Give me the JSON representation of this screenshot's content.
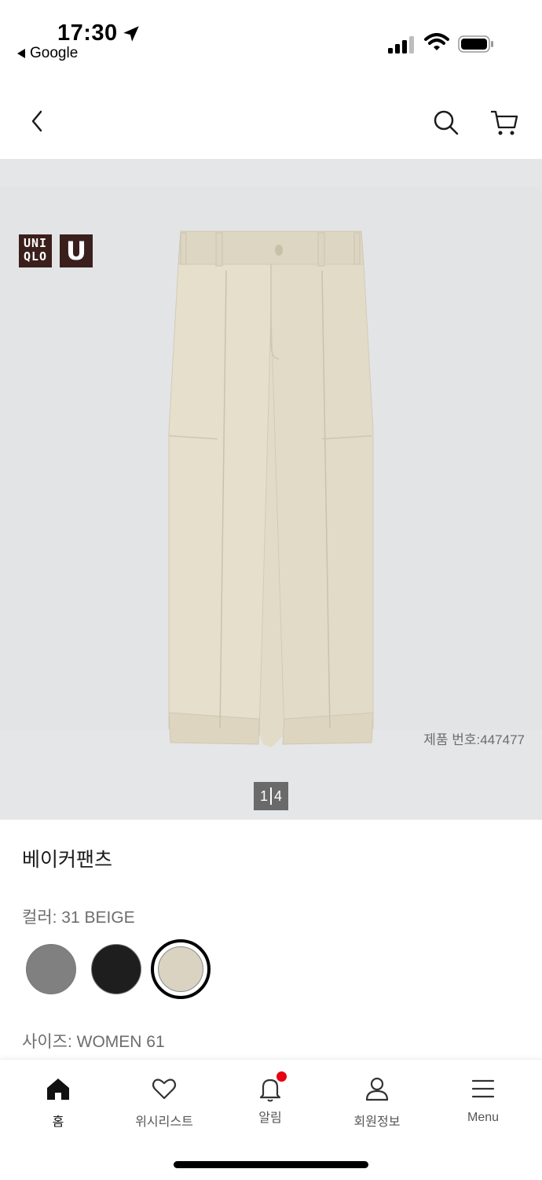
{
  "status_bar": {
    "time": "17:30",
    "back_app": "Google"
  },
  "header": {
    "back_icon": "chevron-left-icon",
    "search_icon": "search-icon",
    "cart_icon": "cart-icon"
  },
  "gallery": {
    "logo_text": "UNIQLO",
    "logo_u": "U",
    "product_number": "제품 번호:447477",
    "pager_current": "1",
    "pager_total": "4"
  },
  "product": {
    "title": "베이커팬츠",
    "color_label": "컬러: 31 BEIGE",
    "colors": [
      "#808080",
      "#1e1e1e",
      "#dad3c2"
    ],
    "selected_color_index": 2,
    "size_label": "사이즈: WOMEN 61"
  },
  "bottom_nav": {
    "items": [
      {
        "label": "홈",
        "icon": "home-icon"
      },
      {
        "label": "위시리스트",
        "icon": "heart-icon"
      },
      {
        "label": "알림",
        "icon": "bell-icon"
      },
      {
        "label": "회원정보",
        "icon": "user-icon"
      },
      {
        "label": "Menu",
        "icon": "menu-icon"
      }
    ]
  },
  "colors": {
    "brand": "#3b1f1c",
    "badge": "#e60012",
    "gallery_bg": "#e5e6e8"
  }
}
